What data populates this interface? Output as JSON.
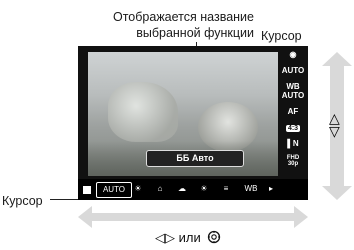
{
  "callouts": {
    "function_name": "Отображается название\nвыбранной функции",
    "cursor_top": "Курсор",
    "cursor_left": "Курсор"
  },
  "screen": {
    "function_box_label": "ББ Авто",
    "side_items": [
      "◉",
      "AUTO",
      "WB\nAUTO",
      "AF",
      "4:3",
      "▌N",
      "FHD\n30p"
    ],
    "bar_items": [
      "AUTO",
      "☀",
      "⌂",
      "☁",
      "☀",
      "≡",
      "WB",
      "▸"
    ]
  },
  "hints": {
    "vertical_symbol": "△\n▽",
    "horizontal_text": "◁▷ или",
    "dial_icon": "dial-icon"
  }
}
